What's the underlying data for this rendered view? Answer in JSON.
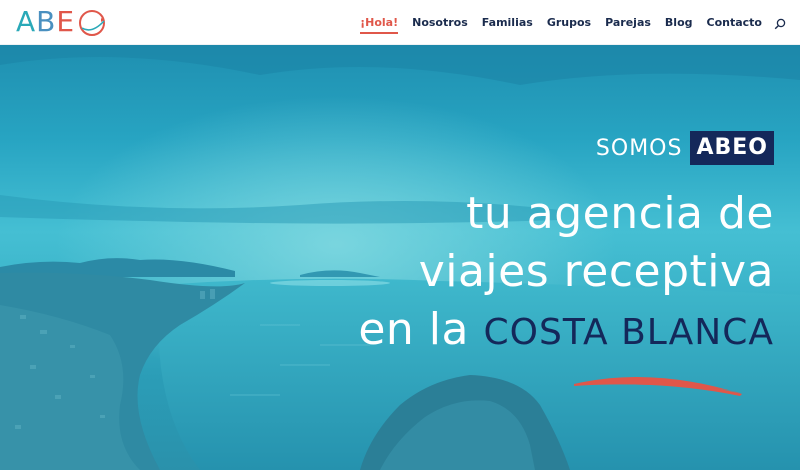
{
  "logo": {
    "letters": [
      "A",
      "B",
      "E",
      "O"
    ],
    "colors": {
      "teal": "#2aa9b8",
      "blue": "#4a90c0",
      "coral": "#e0574a"
    }
  },
  "nav": {
    "items": [
      {
        "label": "¡Hola!",
        "active": true
      },
      {
        "label": "Nosotros",
        "active": false
      },
      {
        "label": "Familias",
        "active": false
      },
      {
        "label": "Grupos",
        "active": false
      },
      {
        "label": "Parejas",
        "active": false
      },
      {
        "label": "Blog",
        "active": false
      },
      {
        "label": "Contacto",
        "active": false
      }
    ],
    "search_icon": "search-icon"
  },
  "hero": {
    "somos_label": "SOMOS",
    "badge": "ABEO",
    "headline_line1": "tu agencia de",
    "headline_line2": "viajes receptiva",
    "headline_line3_prefix": "en la",
    "headline_line3_accent": "COSTA BLANCA"
  },
  "colors": {
    "navy": "#14285a",
    "coral": "#e0574a",
    "nav_text": "#1a2b4d",
    "sea": "#2ba6c0"
  }
}
